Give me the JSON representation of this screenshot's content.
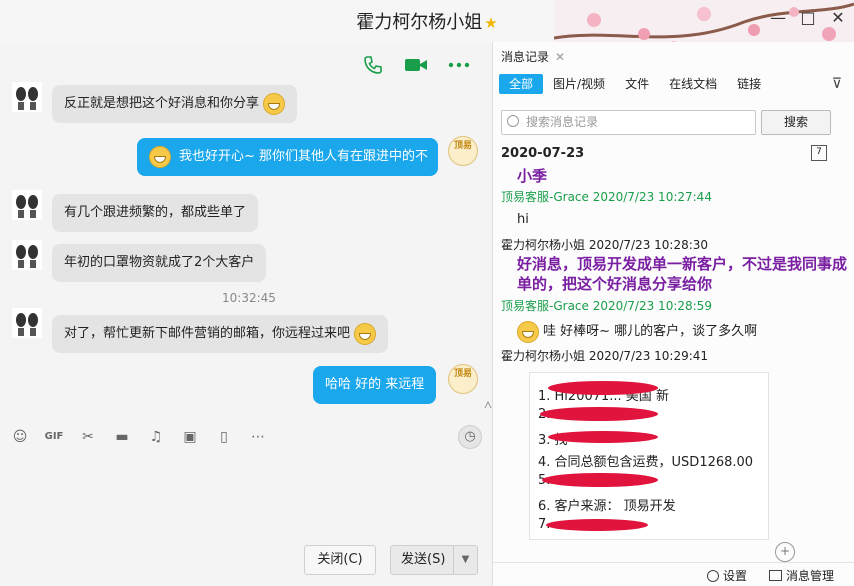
{
  "window": {
    "title": "霍力柯尔杨小姐",
    "controls": [
      "—",
      "□",
      "✕"
    ]
  },
  "chat": {
    "messages": [
      {
        "side": "left",
        "text": "反正就是想把这个好消息和你分享",
        "emoji": "grin"
      },
      {
        "side": "right",
        "text": "我也好开心~ 那你们其他人有在跟进中的不",
        "emoji": "smile"
      },
      {
        "side": "left",
        "text": "有几个跟进频繁的，都成些单了"
      },
      {
        "side": "left",
        "text": "年初的口罩物资就成了2个大客户"
      },
      {
        "side": "left",
        "text": "对了，帮忙更新下邮件营销的邮箱，你远程过来吧",
        "emoji": "shy"
      },
      {
        "side": "right",
        "text": "哈哈  好的 来远程"
      }
    ],
    "timestamp": "10:32:45",
    "brand_avatar_text": "顶易",
    "close_button": "关闭(C)",
    "send_button": "发送(S)"
  },
  "history": {
    "panel_title": "消息记录",
    "tabs": [
      "全部",
      "图片/视频",
      "文件",
      "在线文档",
      "链接"
    ],
    "search_placeholder": "搜索消息记录",
    "search_button": "搜索",
    "date": "2020-07-23",
    "entries": [
      {
        "sender": "",
        "text": "小季",
        "style": "purple"
      },
      {
        "sender": "顶易客服-Grace 2020/7/23 10:27:44",
        "sender_style": "green",
        "text": "hi",
        "style": "plain"
      },
      {
        "sender": "霍力柯尔杨小姐 2020/7/23 10:28:30",
        "sender_style": "dark",
        "text": "好消息，顶易开发成单一新客户，不过是我同事成单的，把这个好消息分享给你",
        "style": "purple"
      },
      {
        "sender": "顶易客服-Grace 2020/7/23 10:28:59",
        "sender_style": "green",
        "text": "哇 好棒呀~ 哪儿的客户，谈了多久啊",
        "style": "plain"
      },
      {
        "sender": "霍力柯尔杨小姐 2020/7/23 10:29:41",
        "sender_style": "dark",
        "text": "",
        "style": "plain"
      }
    ],
    "image_lines": [
      "1. Hi20071... 美国 新",
      "2.",
      "3. 找",
      "4. 合同总额包含运费，USD1268.00",
      "5.",
      "6. 客户来源： 顶易开发",
      "7."
    ],
    "footer": {
      "settings": "设置",
      "manage": "消息管理"
    }
  }
}
